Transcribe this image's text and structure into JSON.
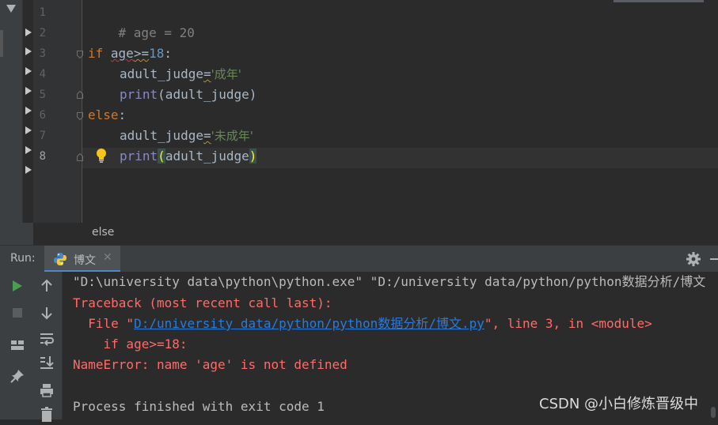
{
  "editor": {
    "line_numbers": [
      "1",
      "2",
      "3",
      "4",
      "5",
      "6",
      "7",
      "8"
    ],
    "current_line": "8",
    "lines": {
      "l1": "# age = 20",
      "l3_kw": "if",
      "l3_var": "age",
      "l3_op": ">=",
      "l3_num": "18",
      "l3_colon": ":",
      "l4_var": "adult_judge",
      "l4_op": "=",
      "l4_str": "'成年'",
      "l5_fn": "print",
      "l5_rest": "(adult_judge)",
      "l6_kw": "else",
      "l6_colon": ":",
      "l7_var": "adult_judge",
      "l7_op": "=",
      "l7_str": "'未成年'",
      "l8_fn": "print",
      "l8_open": "(",
      "l8_arg": "adult_judge",
      "l8_close": ")"
    },
    "breadcrumb": "else"
  },
  "run": {
    "label": "Run:",
    "tab_label": "博文",
    "tab_close": "✕",
    "output": {
      "cmd": "\"D:\\university data\\python\\python.exe\" \"D:/university data/python/python数据分析/博文",
      "traceback": "Traceback (most recent call last):",
      "file_prefix": "  File \"",
      "file_link": "D:/university data/python/python数据分析/博文.py",
      "file_suffix": "\", line 3, in <module>",
      "code_line": "    if age>=18:",
      "error": "NameError: name 'age' is not defined",
      "process": "Process finished with exit code 1"
    }
  },
  "watermark": "CSDN @小白修炼晋级中",
  "colors": {
    "background": "#2b2b2b",
    "panel": "#3c3f41",
    "error_text": "#ff6b68",
    "link": "#287bde",
    "run_green": "#499c54"
  },
  "icons": [
    "collapse-arrow-icon",
    "lightbulb-icon",
    "python-icon",
    "gear-icon",
    "run-icon",
    "stop-icon",
    "layout-icon",
    "pin-icon",
    "up-arrow-icon",
    "down-arrow-icon",
    "soft-wrap-icon",
    "scroll-to-end-icon",
    "print-icon",
    "trash-icon"
  ]
}
